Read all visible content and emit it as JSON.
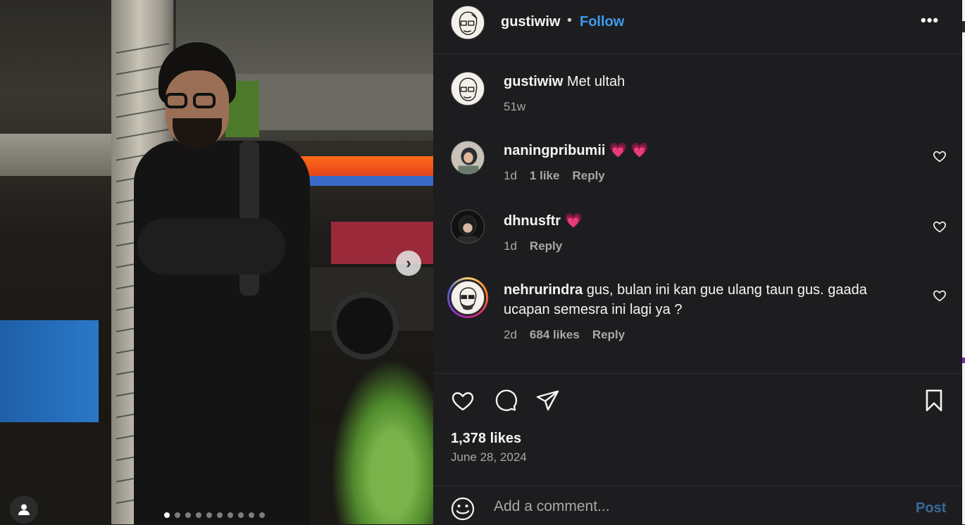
{
  "post": {
    "author": "gustiwiw",
    "follow_label": "Follow",
    "separator": "•",
    "more_icon": "more-options-icon",
    "more_label": "•••",
    "next_label": "›",
    "carousel_total": 10,
    "carousel_active": 1
  },
  "caption": {
    "username": "gustiwiw",
    "text": "Met ultah",
    "time": "51w"
  },
  "comments": [
    {
      "username": "naningpribumii",
      "text": "",
      "emoji": "💗 💗",
      "time": "1d",
      "likes": "1 like",
      "reply": "Reply"
    },
    {
      "username": "dhnusftr",
      "text": "",
      "emoji": "💗",
      "time": "1d",
      "likes": "",
      "reply": "Reply"
    },
    {
      "username": "nehrurindra",
      "text": "gus, bulan ini kan gue ulang taun gus. gaada ucapan semesra ini lagi ya ?",
      "emoji": "",
      "time": "2d",
      "likes": "684 likes",
      "reply": "Reply"
    }
  ],
  "stats": {
    "likes": "1,378 likes",
    "date": "June 28, 2024"
  },
  "add_comment": {
    "placeholder": "Add a comment...",
    "post_label": "Post"
  },
  "colors": {
    "accent": "#3d9cf0",
    "background": "#1d1d20",
    "muted": "#a8a8a8",
    "heart": "#ff3d84"
  }
}
